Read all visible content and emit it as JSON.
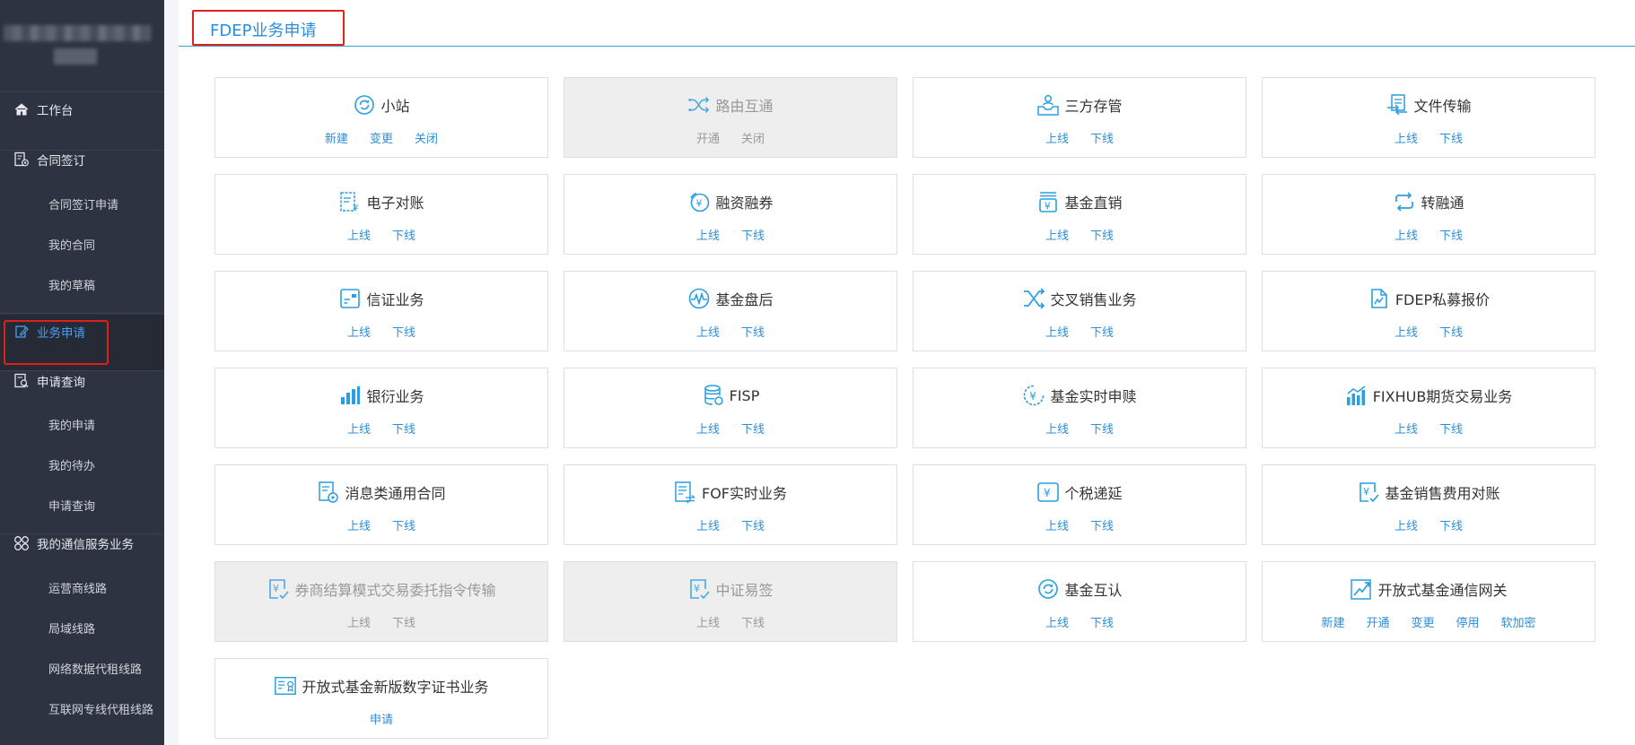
{
  "sidebar": {
    "items": [
      {
        "label": "工作台",
        "icon": "home-icon"
      },
      {
        "label": "合同签订",
        "icon": "contract-icon",
        "children": [
          "合同签订申请",
          "我的合同",
          "我的草稿"
        ]
      },
      {
        "label": "业务申请",
        "icon": "edit-icon",
        "active": true
      },
      {
        "label": "申请查询",
        "icon": "query-doc-icon",
        "children": [
          "我的申请",
          "我的待办",
          "申请查询"
        ]
      },
      {
        "label": "我的通信服务业务",
        "icon": "apps-icon",
        "children": [
          "运营商线路",
          "局域线路",
          "网络数据代租线路",
          "互联网专线代租线路"
        ]
      }
    ]
  },
  "header": {
    "title": "FDEP业务申请"
  },
  "accent_color": "#2e8ed8",
  "cards": [
    {
      "title": "小站",
      "icon": "refresh-circle-icon",
      "disabled": false,
      "actions": [
        "新建",
        "变更",
        "关闭"
      ]
    },
    {
      "title": "路由互通",
      "icon": "shuffle-route-icon",
      "disabled": true,
      "actions": [
        "开通",
        "关闭"
      ]
    },
    {
      "title": "三方存管",
      "icon": "inbox-person-icon",
      "disabled": false,
      "actions": [
        "上线",
        "下线"
      ]
    },
    {
      "title": "文件传输",
      "icon": "file-transfer-icon",
      "disabled": false,
      "actions": [
        "上线",
        "下线"
      ]
    },
    {
      "title": "电子对账",
      "icon": "e-bill-icon",
      "disabled": false,
      "actions": [
        "上线",
        "下线"
      ]
    },
    {
      "title": "融资融券",
      "icon": "yen-coin-icon",
      "disabled": false,
      "actions": [
        "上线",
        "下线"
      ]
    },
    {
      "title": "基金直销",
      "icon": "yen-stack-icon",
      "disabled": false,
      "actions": [
        "上线",
        "下线"
      ]
    },
    {
      "title": "转融通",
      "icon": "swap-arrows-icon",
      "disabled": false,
      "actions": [
        "上线",
        "下线"
      ]
    },
    {
      "title": "信证业务",
      "icon": "card-icon",
      "disabled": false,
      "actions": [
        "上线",
        "下线"
      ]
    },
    {
      "title": "基金盘后",
      "icon": "pulse-icon",
      "disabled": false,
      "actions": [
        "上线",
        "下线"
      ]
    },
    {
      "title": "交叉销售业务",
      "icon": "cross-arrows-icon",
      "disabled": false,
      "actions": [
        "上线",
        "下线"
      ]
    },
    {
      "title": "FDEP私募报价",
      "icon": "doc-quote-icon",
      "disabled": false,
      "actions": [
        "上线",
        "下线"
      ]
    },
    {
      "title": "银衍业务",
      "icon": "bar-chart-icon",
      "disabled": false,
      "actions": [
        "上线",
        "下线"
      ]
    },
    {
      "title": "FISP",
      "icon": "database-icon",
      "disabled": false,
      "actions": [
        "上线",
        "下线"
      ]
    },
    {
      "title": "基金实时申赎",
      "icon": "yen-circle-icon",
      "disabled": false,
      "actions": [
        "上线",
        "下线"
      ]
    },
    {
      "title": "FIXHUB期货交易业务",
      "icon": "growth-bars-icon",
      "disabled": false,
      "actions": [
        "上线",
        "下线"
      ]
    },
    {
      "title": "消息类通用合同",
      "icon": "message-doc-icon",
      "disabled": false,
      "actions": [
        "上线",
        "下线"
      ]
    },
    {
      "title": "FOF实时业务",
      "icon": "doc-transfer-icon",
      "disabled": false,
      "actions": [
        "上线",
        "下线"
      ]
    },
    {
      "title": "个税递延",
      "icon": "yen-box-icon",
      "disabled": false,
      "actions": [
        "上线",
        "下线"
      ]
    },
    {
      "title": "基金销售费用对账",
      "icon": "yen-check-icon",
      "disabled": false,
      "actions": [
        "上线",
        "下线"
      ]
    },
    {
      "title": "券商结算模式交易委托指令传输",
      "icon": "yen-check-icon",
      "disabled": true,
      "actions": [
        "上线",
        "下线"
      ]
    },
    {
      "title": "中证易签",
      "icon": "yen-check-icon",
      "disabled": true,
      "actions": [
        "上线",
        "下线"
      ]
    },
    {
      "title": "基金互认",
      "icon": "refresh-circle-icon",
      "disabled": false,
      "actions": [
        "上线",
        "下线"
      ]
    },
    {
      "title": "开放式基金通信网关",
      "icon": "trend-up-icon",
      "disabled": false,
      "actions": [
        "新建",
        "开通",
        "变更",
        "停用",
        "软加密"
      ]
    },
    {
      "title": "开放式基金新版数字证书业务",
      "icon": "certificate-icon",
      "disabled": false,
      "actions": [
        "申请"
      ]
    }
  ]
}
